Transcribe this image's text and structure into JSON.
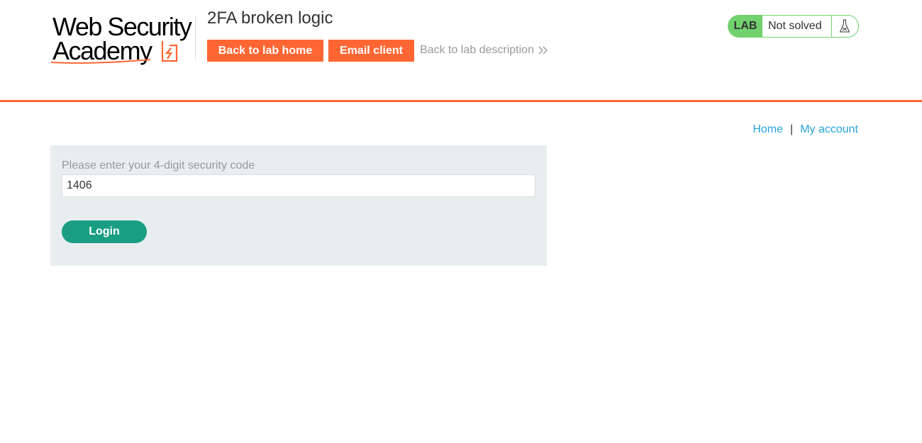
{
  "brand": {
    "logo_line1": "Web Security",
    "logo_line2": "Academy",
    "accent_color": "#ff6633"
  },
  "header": {
    "lab_title": "2FA broken logic",
    "back_to_lab_home": "Back to lab home",
    "email_client": "Email client",
    "back_to_lab_description": "Back to lab description"
  },
  "lab_status": {
    "badge": "LAB",
    "state": "Not solved",
    "icon": "flask-icon",
    "color": "#70d16d"
  },
  "nav": {
    "home": "Home",
    "separator": "|",
    "my_account": "My account"
  },
  "form": {
    "label": "Please enter your 4-digit security code",
    "code_value": "1406",
    "submit_label": "Login",
    "submit_color": "#1a9e83"
  }
}
